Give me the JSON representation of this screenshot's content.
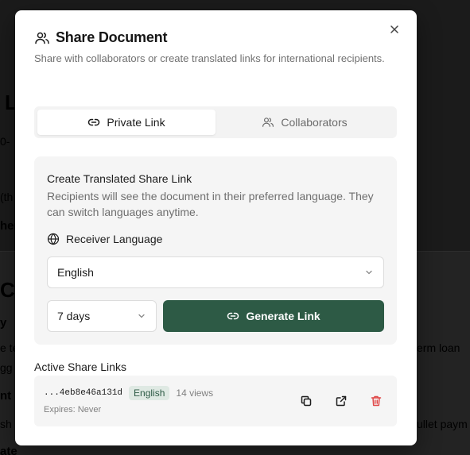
{
  "background": {
    "frag_l": "L",
    "frag_0": "0-",
    "frag_t": "(th",
    "frag_her": "her",
    "frag_c": "C",
    "frag_y": "y",
    "frag_te": "e te",
    "frag_g": "gg",
    "frag_nt": "nt",
    "frag_sh": "sh",
    "frag_ate": "ate",
    "frag_termloan": "erm loan",
    "frag_ulletpay": "ullet paym"
  },
  "dialog": {
    "title": "Share Document",
    "subtitle": "Share with collaborators or create translated links for international recipients.",
    "close_icon": "close-icon"
  },
  "tabs": [
    {
      "label": "Private Link",
      "icon": "link-icon",
      "active": true
    },
    {
      "label": "Collaborators",
      "icon": "users-icon",
      "active": false
    }
  ],
  "translated_link": {
    "title": "Create Translated Share Link",
    "description": "Recipients will see the document in their preferred language. They can switch languages anytime.",
    "language_label": "Receiver Language",
    "language_value": "English",
    "expiry_value": "7 days",
    "generate_label": "Generate Link"
  },
  "active_links": {
    "title": "Active Share Links",
    "items": [
      {
        "id": "...4eb8e46a131d",
        "language": "English",
        "views": "14 views",
        "expires": "Expires: Never"
      }
    ]
  },
  "colors": {
    "accent": "#2d5a45",
    "danger": "#e04848",
    "badge_bg": "#dfe9e3"
  }
}
